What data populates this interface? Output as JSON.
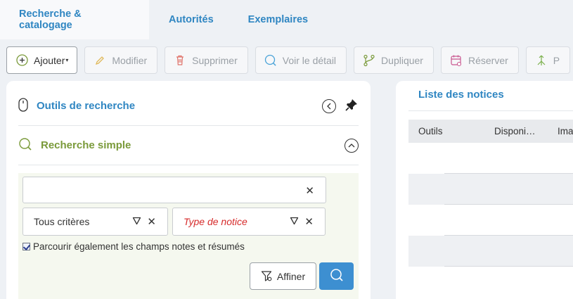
{
  "tabs": [
    {
      "label": "Recherche & catalogage",
      "active": true
    },
    {
      "label": "Autorités",
      "active": false
    },
    {
      "label": "Exemplaires",
      "active": false
    }
  ],
  "toolbar": {
    "add_label": "Ajouter",
    "modify_label": "Modifier",
    "delete_label": "Supprimer",
    "view_label": "Voir le détail",
    "duplicate_label": "Dupliquer",
    "reserve_label": "Réserver",
    "next_label": "P"
  },
  "search_tools": {
    "title": "Outils de recherche",
    "simple_title": "Recherche simple",
    "query_value": "",
    "criteria_value": "Tous critères",
    "notice_type_placeholder": "Type de notice",
    "also_notes_label": "Parcourir également les champs notes et résumés",
    "also_notes_checked": true,
    "refine_label": "Affiner"
  },
  "notices": {
    "title": "Liste des notices",
    "columns": [
      "Outils",
      "Disponi…",
      "Ima"
    ]
  },
  "colors": {
    "accent_blue": "#2f86c2",
    "accent_green": "#7a9a3a",
    "search_button": "#3d8fd1",
    "placeholder_red": "#d62b2b"
  }
}
